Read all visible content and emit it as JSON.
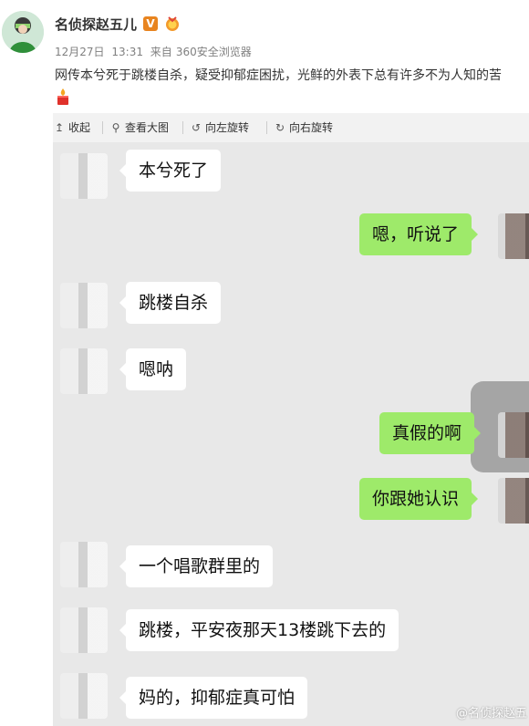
{
  "post": {
    "username": "名侦探赵五儿",
    "vip_badge": "V",
    "date": "12月27日",
    "time": "13:31",
    "source_prefix": "来自",
    "source": "360安全浏览器",
    "text": "网传本兮死于跳楼自杀，疑受抑郁症困扰，光鲜的外表下总有许多不为人知的苦"
  },
  "toolbar": {
    "collapse_label": "收起",
    "view_large_label": "查看大图",
    "rotate_left_label": "向左旋转",
    "rotate_right_label": "向右旋转"
  },
  "chat": {
    "messages": [
      {
        "side": "left",
        "text": "本兮死了"
      },
      {
        "side": "right",
        "text": "嗯，听说了"
      },
      {
        "side": "left",
        "text": "跳楼自杀"
      },
      {
        "side": "left",
        "text": "嗯呐"
      },
      {
        "side": "right",
        "text": "真假的啊"
      },
      {
        "side": "right",
        "text": "你跟她认识"
      },
      {
        "side": "left",
        "text": "一个唱歌群里的"
      },
      {
        "side": "left",
        "text": "跳楼，平安夜那天13楼跳下去的"
      },
      {
        "side": "left",
        "text": "妈的，抑郁症真可怕"
      }
    ],
    "watermark": "@名侦探赵五"
  },
  "colors": {
    "chat_background": "#e8e8e8",
    "incoming_bubble": "#ffffff",
    "outgoing_bubble": "#9eea6a",
    "toolbar_background": "#f2f2f2",
    "vip_badge": "#e8841f"
  }
}
